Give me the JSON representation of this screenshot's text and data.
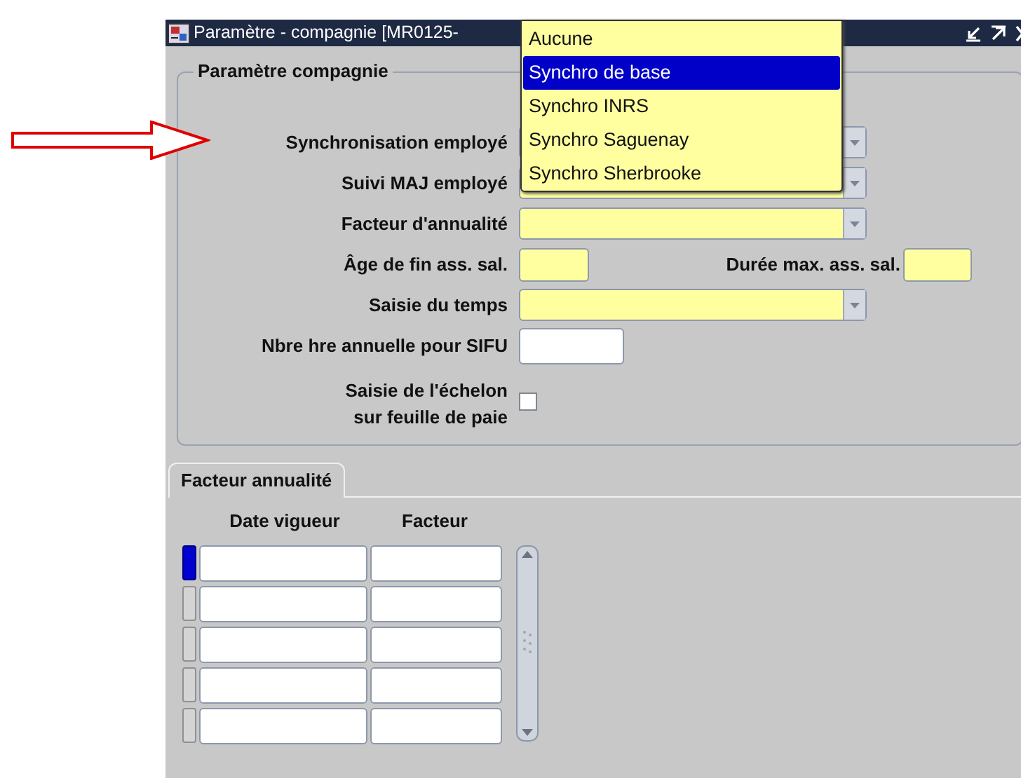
{
  "window": {
    "title": "Paramètre - compagnie [MR0125-"
  },
  "group": {
    "title": "Paramètre compagnie"
  },
  "fields": [
    {
      "kind": "combo",
      "label": "Synchronisation employé"
    },
    {
      "kind": "combo",
      "label": "Suivi MAJ employé"
    },
    {
      "kind": "combo",
      "label": "Facteur d'annualité"
    },
    {
      "kind": "pair",
      "label": "Âge de fin ass. sal.",
      "label_2": "Durée max. ass. sal."
    },
    {
      "kind": "combo",
      "label": "Saisie du temps"
    },
    {
      "kind": "text",
      "label": "Nbre hre annuelle pour SIFU"
    },
    {
      "kind": "checkbox",
      "label": "Saisie de l'échelon\nsur feuille de paie",
      "checked": false
    }
  ],
  "dropdown": {
    "items": [
      {
        "label": "Aucune",
        "selected": false
      },
      {
        "label": "Synchro de base",
        "selected": true
      },
      {
        "label": "Synchro INRS",
        "selected": false
      },
      {
        "label": "Synchro Saguenay",
        "selected": false
      },
      {
        "label": "Synchro Sherbrooke",
        "selected": false
      }
    ]
  },
  "tabs": [
    {
      "label": "Facteur annualité",
      "selected": true
    }
  ],
  "table": {
    "columns": [
      "Date vigueur",
      "Facteur"
    ],
    "rows": [
      {
        "selected": true
      },
      {
        "selected": false
      },
      {
        "selected": false
      },
      {
        "selected": false
      },
      {
        "selected": false
      }
    ]
  }
}
